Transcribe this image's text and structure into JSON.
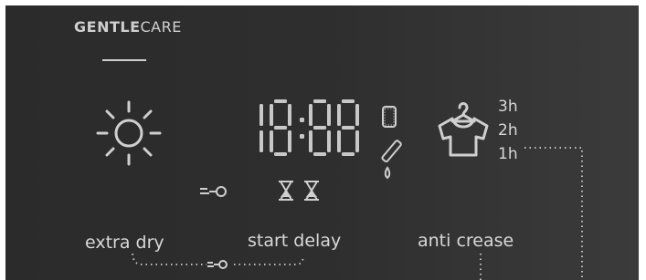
{
  "brand": {
    "bold": "GENTLE",
    "light": "CARE"
  },
  "display": {
    "digits": "18:88"
  },
  "labels": {
    "extra_dry": "extra dry",
    "start_delay": "start delay",
    "anti_crease": "anti crease"
  },
  "anti_crease_hours": [
    "3h",
    "2h",
    "1h"
  ],
  "colors": {
    "panel_bg": "#2e2e2e",
    "segment": "#c8c8c8",
    "text": "#d8d8d8"
  },
  "icons": [
    "sun-icon",
    "key-lock-icon",
    "hourglass-icon",
    "water-tank-icon",
    "drain-icon",
    "hanger-shirt-icon"
  ]
}
